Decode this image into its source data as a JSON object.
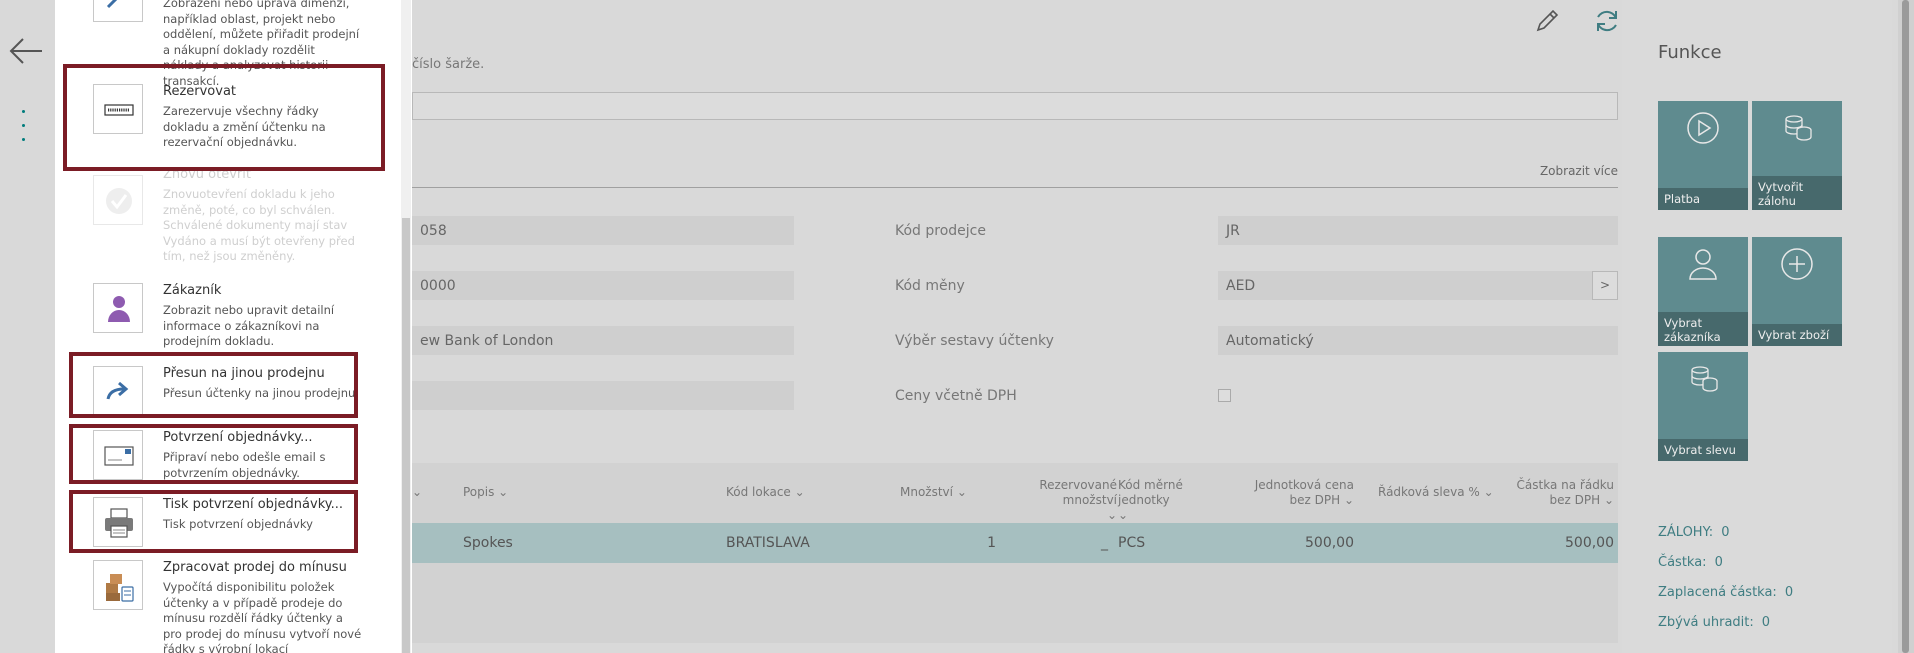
{
  "main": {
    "hint_text": "číslo šarže.",
    "show_more": "Zobrazit více",
    "fields": {
      "left1_value": "058",
      "left2_value": "0000",
      "left3_value": "ew Bank of London",
      "salesperson_label": "Kód prodejce",
      "salesperson_value": "JR",
      "currency_label": "Kód měny",
      "currency_value": "AED",
      "currency_lookup": ">",
      "report_sel_label": "Výběr sestavy účtenky",
      "report_sel_value": "Automatický",
      "prices_vat_label": "Ceny včetně DPH"
    },
    "table": {
      "headers": [
        "Popis",
        "Kód lokace",
        "Množství",
        "Rezervované množství",
        "Kód měrné jednotky",
        "Jednotková cena bez DPH",
        "Řádková sleva %",
        "Částka na řádku bez DPH"
      ],
      "row": {
        "popis": "Spokes",
        "lokace": "BRATISLAVA",
        "mnozstvi": "1",
        "rezervovane": "_",
        "jednotka": "PCS",
        "cena": "500,00",
        "castka": "500,00"
      }
    }
  },
  "functions": {
    "title": "Funkce",
    "tiles": {
      "platba": "Platba",
      "zaloha": "Vytvořit zálohu",
      "zakaznik": "Vybrat zákazníka",
      "zbozi": "Vybrat zboží",
      "sleva": "Vybrat slevu"
    },
    "stats": [
      {
        "label": "ZÁLOHY:",
        "value": "0"
      },
      {
        "label": "Částka:",
        "value": "0"
      },
      {
        "label": "Zaplacená částka:",
        "value": "0"
      },
      {
        "label": "Zbývá uhradit:",
        "value": "0"
      }
    ]
  },
  "menu": {
    "top_partial_desc": "Zobrazení nebo úprava dimenzí, například oblast, projekt nebo oddělení, můžete přiřadit prodejní a nákupní doklady rozdělit náklady a analyzovat historii transakcí.",
    "items": [
      {
        "title": "Rezervovat",
        "desc": "Zarezervuje všechny řádky dokladu a změní účtenku na rezervační objednávku."
      },
      {
        "title": "Znovu otevřít",
        "desc": "Znovuotevření dokladu k jeho změně, poté, co byl schválen. Schválené dokumenty mají stav Vydáno a musí být otevřeny před tím, než jsou změněny."
      },
      {
        "title": "Zákazník",
        "desc": "Zobrazit nebo upravit detailní informace o zákazníkovi na prodejním dokladu."
      },
      {
        "title": "Přesun na jinou prodejnu",
        "desc": "Přesun účtenky na jinou prodejnu"
      },
      {
        "title": "Potvrzení objednávky...",
        "desc": "Připraví nebo odešle email s potvrzením objednávky."
      },
      {
        "title": "Tisk potvrzení objednávky...",
        "desc": "Tisk potvrzení objednávky"
      },
      {
        "title": "Zpracovat prodej do mínusu",
        "desc": "Vypočítá disponibilitu položek účtenky a v případě prodeje do mínusu rozdělí řádky účtenky a pro prodej do mínusu vytvoří nové řádky s výrobní lokací"
      }
    ]
  },
  "colors": {
    "highlight": "#7b1c25",
    "tile": "#5f8b8f",
    "tile_label": "#47696c",
    "row_selected": "#a6bfc0",
    "accent": "#007c7c"
  }
}
